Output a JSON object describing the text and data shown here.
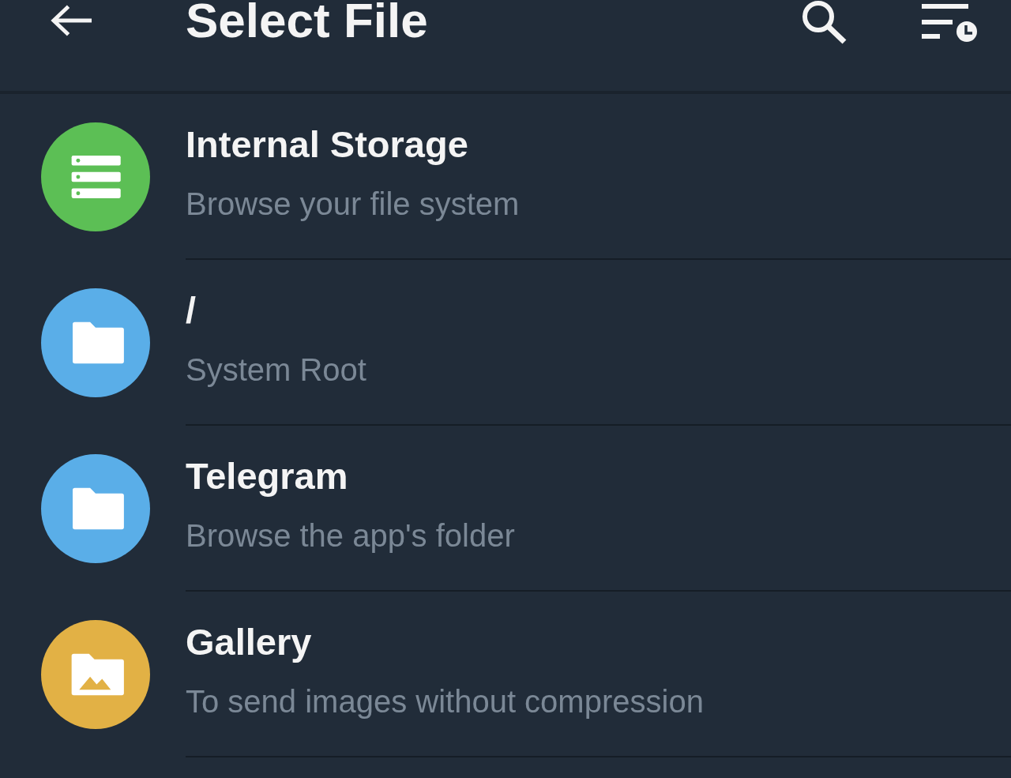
{
  "header": {
    "title": "Select File"
  },
  "items": [
    {
      "kind": "storage",
      "title": "Internal Storage",
      "subtitle": "Browse your file system",
      "color": "#5cbf55"
    },
    {
      "kind": "folder",
      "title": "/",
      "subtitle": "System Root",
      "color": "#5aaee8"
    },
    {
      "kind": "folder",
      "title": "Telegram",
      "subtitle": "Browse the app's folder",
      "color": "#5aaee8"
    },
    {
      "kind": "gallery",
      "title": "Gallery",
      "subtitle": "To send images without compression",
      "color": "#e2b145"
    }
  ]
}
